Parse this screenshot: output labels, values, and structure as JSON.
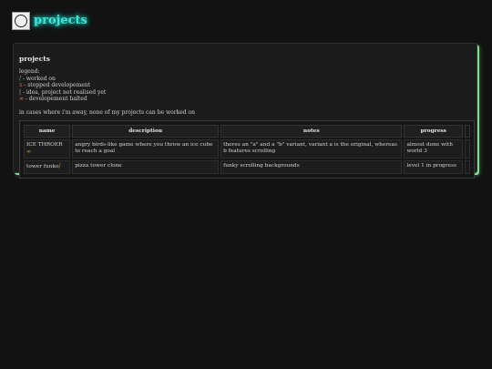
{
  "site": {
    "title": "projects"
  },
  "card": {
    "title": "projects",
    "legend_heading": "legend:",
    "legend": [
      {
        "symbol": "/",
        "symbol_color": "green",
        "text": " - worked on"
      },
      {
        "symbol": "x",
        "symbol_color": "red",
        "text": " - stopped developement"
      },
      {
        "symbol": "|",
        "symbol_color": "gray",
        "text": " - idea, project not realised yet"
      },
      {
        "symbol": "∞",
        "symbol_color": "orange",
        "text": " - developement halted"
      }
    ],
    "away_note": "in cases where i'm away, none of my projects can be worked on"
  },
  "table": {
    "headers": [
      "name",
      "description",
      "notes",
      "progress"
    ],
    "rows": [
      {
        "name": "ICE THROER",
        "status_symbol": "∞",
        "description": "angry birds-like game where you throw an ice cube to reach a goal",
        "notes": "theres an \"a\" and a \"b\" variant, variant a is the original, whereas b features scrolling",
        "progress": "almost done with world 3"
      },
      {
        "name": "tower funko",
        "status_symbol": "/",
        "description": "pizza tower clone",
        "notes": "funky scrolling backgrounds",
        "progress": "level 1 in progress"
      }
    ]
  },
  "colors": {
    "title_glow": "#39e6d8",
    "card_shadow": "#7fe08a",
    "background": "#121212"
  }
}
